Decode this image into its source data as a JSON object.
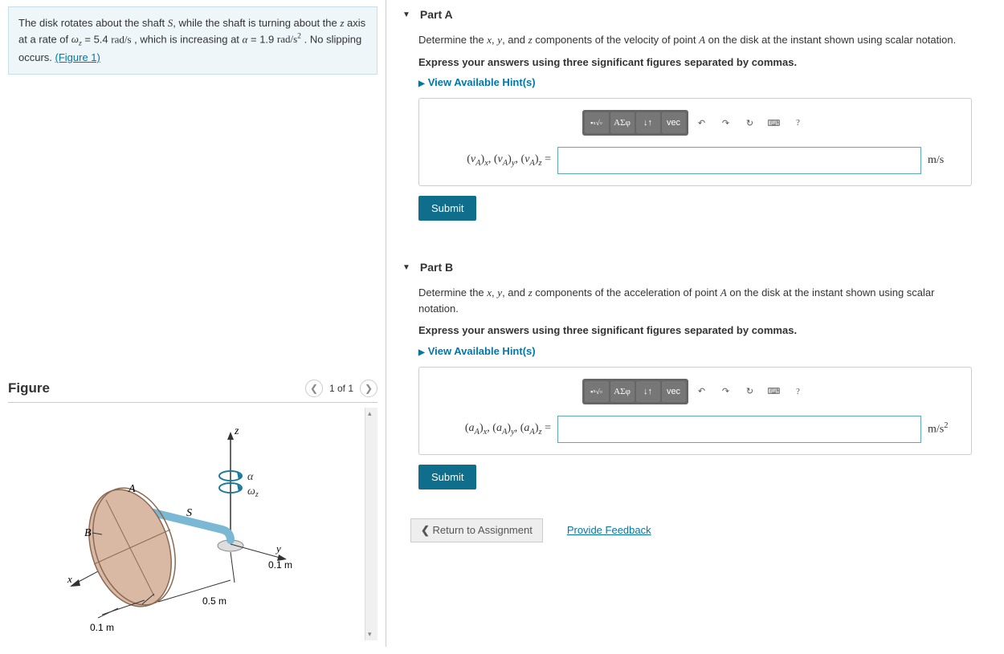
{
  "problem": {
    "text_pre": "The disk rotates about the shaft ",
    "shaft": "S",
    "text_mid1": ", while the shaft is turning about the ",
    "axis": "z",
    "text_mid2": " axis at a rate of ",
    "omega_sym": "ω",
    "omega_sub": "z",
    "omega_eq": " = 5.4 ",
    "omega_unit": "rad/s",
    "text_mid3": " , which is increasing at ",
    "alpha_sym": "α",
    "alpha_eq": " = 1.9 ",
    "alpha_unit": "rad/s",
    "alpha_exp": "2",
    "text_end": " . No slipping occurs. ",
    "figure_link": "(Figure 1)"
  },
  "figure": {
    "title": "Figure",
    "counter": "1 of 1",
    "labels": {
      "z": "z",
      "y": "y",
      "x": "x",
      "alpha": "α",
      "omega": "ω",
      "omega_sub": "z",
      "A": "A",
      "B": "B",
      "S": "S",
      "d1": "0.1 m",
      "d2": "0.5 m",
      "d3": "0.1 m"
    }
  },
  "partA": {
    "title": "Part A",
    "instr_pre": "Determine the ",
    "x": "x",
    "y": "y",
    "z": "z",
    "instr_mid": " components of the velocity of point ",
    "point": "A",
    "instr_end": " on the disk at the instant shown using scalar notation.",
    "instr2": "Express your answers using three significant figures separated by commas.",
    "hints": "View Available Hint(s)",
    "var_label_html": "(v_A)_x, (v_A)_y, (v_A)_z =",
    "unit": "m/s",
    "submit": "Submit"
  },
  "partB": {
    "title": "Part B",
    "instr_pre": "Determine the ",
    "x": "x",
    "y": "y",
    "z": "z",
    "instr_mid": " components of the acceleration of point ",
    "point": "A",
    "instr_end": " on the disk at the instant shown using scalar notation.",
    "instr2": "Express your answers using three significant figures separated by commas.",
    "hints": "View Available Hint(s)",
    "unit_base": "m/s",
    "unit_exp": "2",
    "submit": "Submit"
  },
  "toolbar": {
    "templates": "√",
    "greek": "ΑΣφ",
    "subscript": "↓↑",
    "vec": "vec",
    "undo": "↶",
    "redo": "↷",
    "reset": "↻",
    "keyboard": "⌨",
    "help": "?"
  },
  "bottom": {
    "return": "Return to Assignment",
    "feedback": "Provide Feedback"
  }
}
